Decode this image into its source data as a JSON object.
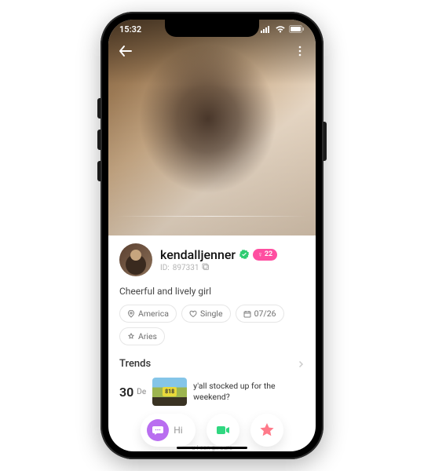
{
  "statusbar": {
    "time": "15:32"
  },
  "profile": {
    "username": "kendalljenner",
    "id_label": "ID:",
    "id_value": "897331",
    "age": "22",
    "gender_symbol": "♀",
    "bio": "Cheerful and lively girl"
  },
  "chips": {
    "location": "America",
    "status": "Single",
    "birthday": "07/26",
    "zodiac": "Aries"
  },
  "trends": {
    "title": "Trends",
    "date_day": "30",
    "date_month": "De",
    "caption": "y'all stocked up for the weekend?"
  },
  "bottombar": {
    "hi_label": "Hi",
    "cutoff_text": "u I can g.. ours"
  }
}
